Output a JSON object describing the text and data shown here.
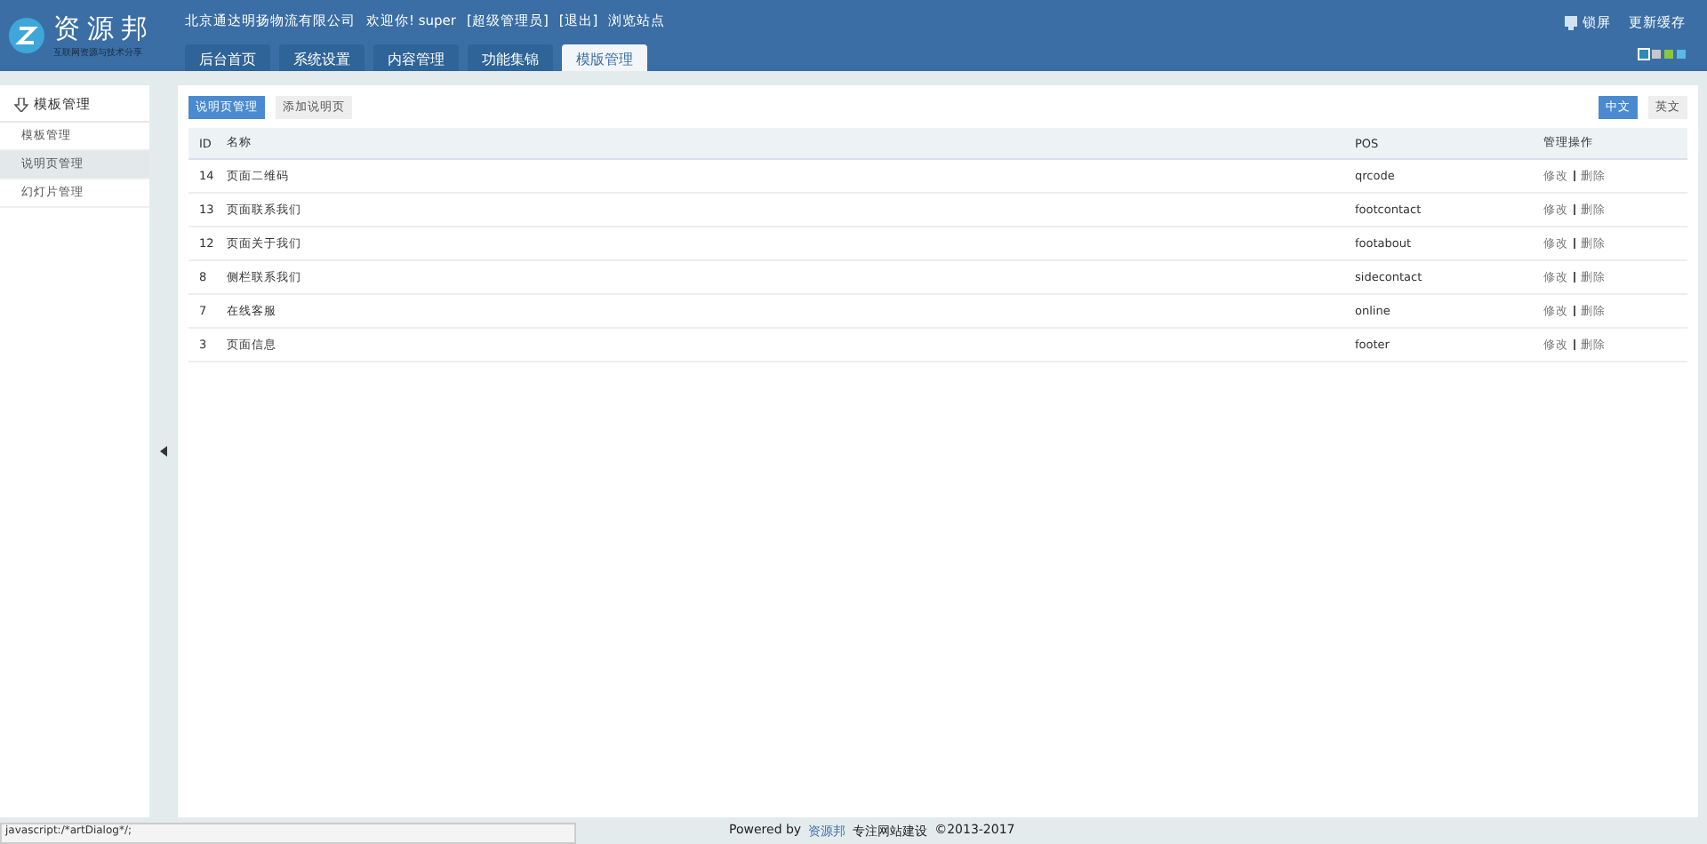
{
  "header": {
    "logo": {
      "title": "资源邦",
      "subtitle": "互联网资源与技术分享"
    },
    "company": "北京通达明扬物流有限公司",
    "welcome": "欢迎你! super",
    "links": [
      "[超级管理员]",
      "[退出]",
      "浏览站点"
    ],
    "actions": [
      "锁屏",
      "更新缓存"
    ],
    "theme_swatches": [
      {
        "color": "#2a8ab8",
        "selected": true
      },
      {
        "color": "#c8c8c8",
        "selected": false
      },
      {
        "color": "#8cc63f",
        "selected": false
      },
      {
        "color": "#5bb8e8",
        "selected": false
      }
    ],
    "tabs": [
      {
        "label": "后台首页",
        "selected": false
      },
      {
        "label": "系统设置",
        "selected": false
      },
      {
        "label": "内容管理",
        "selected": false
      },
      {
        "label": "功能集锦",
        "selected": false
      },
      {
        "label": "模版管理",
        "selected": true
      }
    ]
  },
  "sidebar": {
    "title": "模板管理",
    "items": [
      {
        "label": "模板管理",
        "selected": false
      },
      {
        "label": "说明页管理",
        "selected": true
      },
      {
        "label": "幻灯片管理",
        "selected": false
      }
    ]
  },
  "toolbar": {
    "buttons": [
      {
        "label": "说明页管理",
        "selected": true
      },
      {
        "label": "添加说明页",
        "selected": false
      }
    ],
    "languages": [
      {
        "label": "中文",
        "selected": true
      },
      {
        "label": "英文",
        "selected": false
      }
    ]
  },
  "table": {
    "columns": [
      "ID",
      "名称",
      "POS",
      "管理操作"
    ],
    "rows": [
      {
        "id": "14",
        "name": "页面二维码",
        "pos": "qrcode",
        "actions": [
          "修改",
          "删除"
        ]
      },
      {
        "id": "13",
        "name": "页面联系我们",
        "pos": "footcontact",
        "actions": [
          "修改",
          "删除"
        ]
      },
      {
        "id": "12",
        "name": "页面关于我们",
        "pos": "footabout",
        "actions": [
          "修改",
          "删除"
        ]
      },
      {
        "id": "8",
        "name": "侧栏联系我们",
        "pos": "sidecontact",
        "actions": [
          "修改",
          "删除"
        ]
      },
      {
        "id": "7",
        "name": "在线客服",
        "pos": "online",
        "actions": [
          "修改",
          "删除"
        ]
      },
      {
        "id": "3",
        "name": "页面信息",
        "pos": "footer",
        "actions": [
          "修改",
          "删除"
        ]
      }
    ]
  },
  "footer": {
    "powered": "Powered by",
    "brand": "资源邦",
    "slogan": "专注网站建设",
    "copyright": "©2013-2017"
  },
  "status_bar": "javascript:/*artDialog*/;"
}
